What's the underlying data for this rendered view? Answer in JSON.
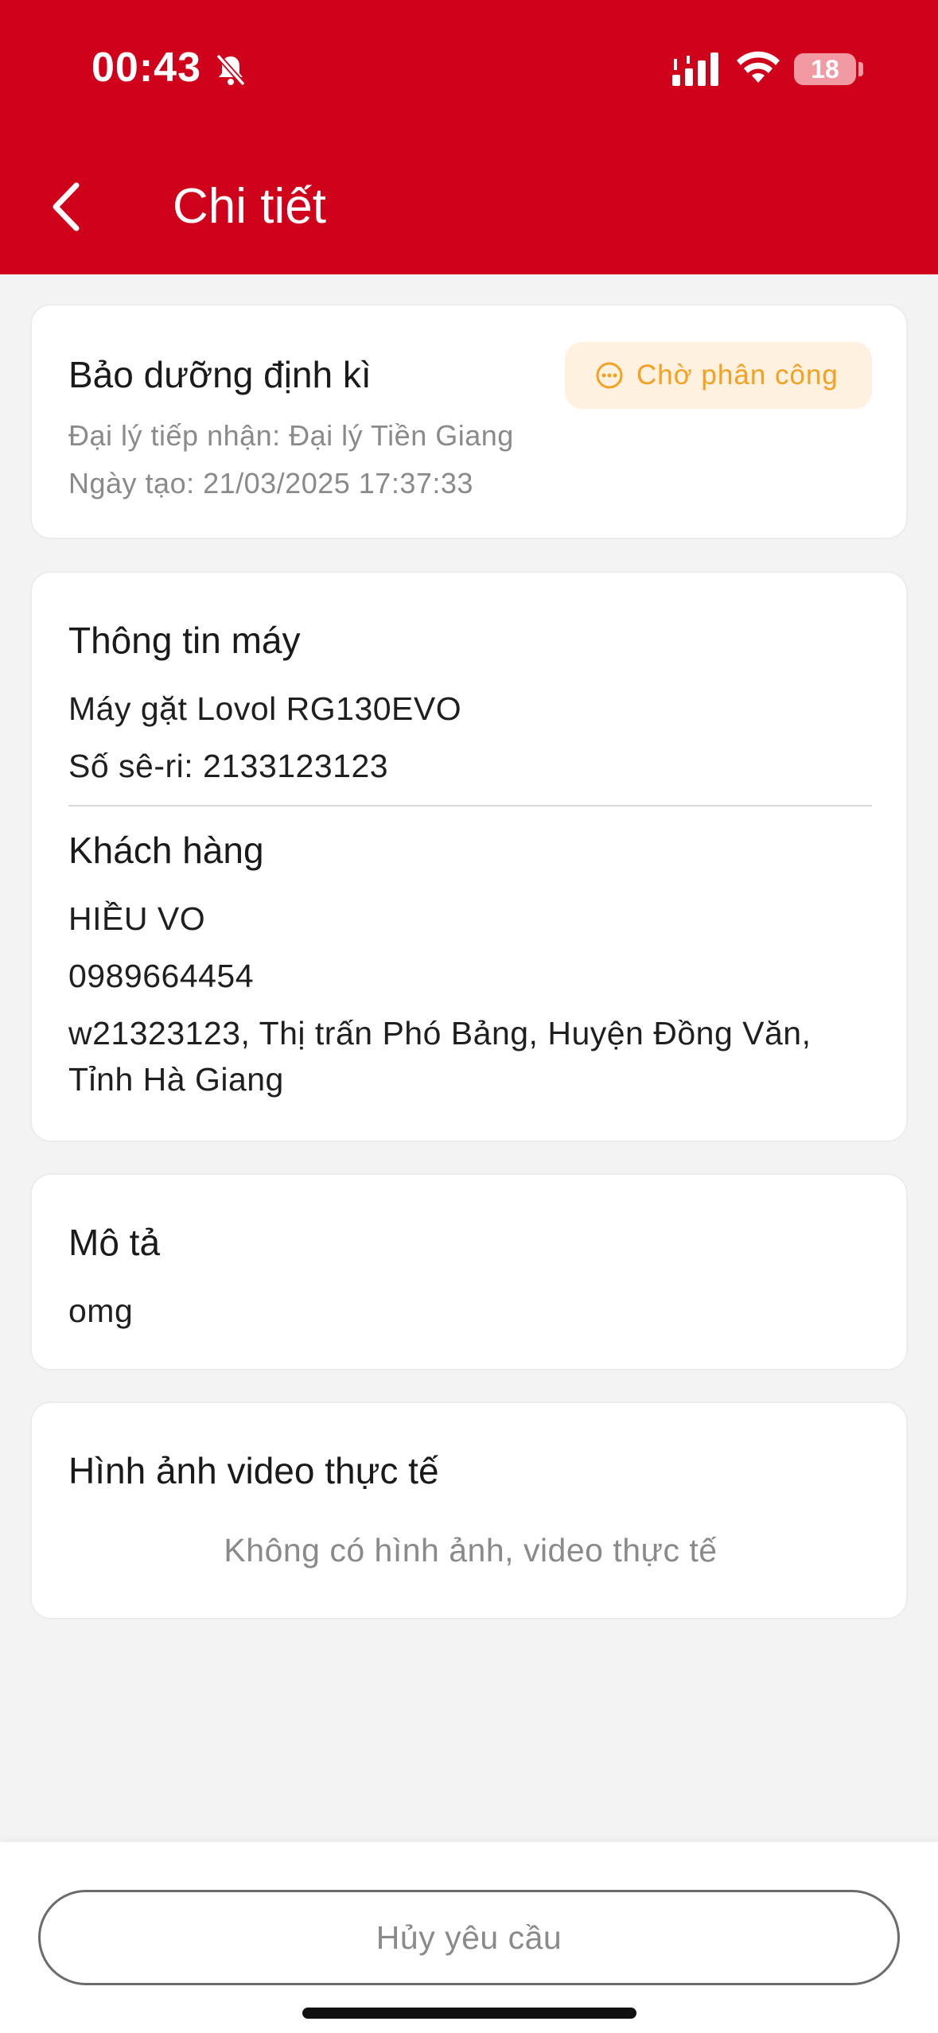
{
  "status_bar": {
    "time": "00:43",
    "battery": "18",
    "icons": [
      "bell-slash-icon",
      "cellular-signal-icon",
      "wifi-icon",
      "battery-icon"
    ]
  },
  "nav": {
    "back_icon": "chevron-left-icon",
    "title": "Chi tiết"
  },
  "colors": {
    "header_bg": "#d0021b",
    "badge_bg": "#fff1e0",
    "badge_text": "#f5a021",
    "page_bg": "#f3f3f3"
  },
  "request": {
    "title": "Bảo dưỡng định kì",
    "status": {
      "icon": "more-circle-icon",
      "label": "Chờ phân công"
    },
    "dealer": "Đại lý tiếp nhận: Đại lý Tiền Giang",
    "created": "Ngày tạo: 21/03/2025 17:37:33"
  },
  "machine": {
    "heading": "Thông tin máy",
    "name": "Máy gặt Lovol RG130EVO",
    "serial": "Số sê-ri: 2133123123"
  },
  "customer": {
    "heading": "Khách hàng",
    "name": "HIỀU VO",
    "phone": "0989664454",
    "address_line1": "w21323123, Thị trấn Phó Bảng, Huyện Đồng Văn,",
    "address_line2": "Tỉnh Hà Giang"
  },
  "description": {
    "heading": "Mô tả",
    "text": "omg"
  },
  "media": {
    "heading": "Hình ảnh video thực tế",
    "empty": "Không có hình ảnh, video thực tế"
  },
  "actions": {
    "cancel_label": "Hủy yêu cầu"
  }
}
